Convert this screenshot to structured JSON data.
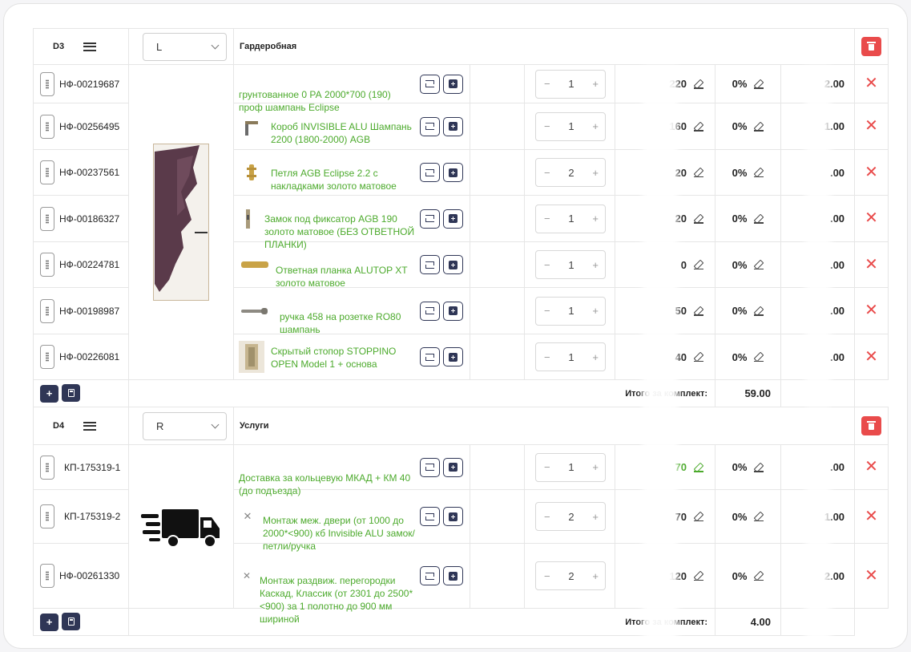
{
  "sets": [
    {
      "code": "D3",
      "side": "L",
      "title": "Гардеробная",
      "total_label": "Итого за комплект:",
      "total": "59.00",
      "rows": [
        {
          "code": "НФ-00219687",
          "name": "грунтованное 0 РА 2000*700 (190) проф шампань Eclipse",
          "qty": "1",
          "price": "220",
          "discount": "0%",
          "sum": "2.00"
        },
        {
          "code": "НФ-00256495",
          "name": "Короб INVISIBLE ALU Шампань 2200 (1800-2000) AGB",
          "qty": "1",
          "price": "160",
          "discount": "0%",
          "sum": "1.00"
        },
        {
          "code": "НФ-00237561",
          "name": "Петля AGB Eclipse 2.2 с накладками золото матовое",
          "qty": "2",
          "price": "20",
          "discount": "0%",
          "sum": ".00"
        },
        {
          "code": "НФ-00186327",
          "name": "Замок под фиксатор AGB 190 золото матовое (БЕЗ ОТВЕТНОЙ ПЛАНКИ)",
          "qty": "1",
          "price": "20",
          "discount": "0%",
          "sum": ".00"
        },
        {
          "code": "НФ-00224781",
          "name": "Ответная планка ALUTOP XT золото матовое",
          "qty": "1",
          "price": "0",
          "discount": "0%",
          "sum": ".00"
        },
        {
          "code": "НФ-00198987",
          "name": "ручка 458 на розетке RO80 шампань",
          "qty": "1",
          "price": "50",
          "discount": "0%",
          "sum": ".00"
        },
        {
          "code": "НФ-00226081",
          "name": "Скрытый стопор STOPPINO OPEN Model 1 + основа",
          "qty": "1",
          "price": "40",
          "discount": "0%",
          "sum": ".00"
        }
      ]
    },
    {
      "code": "D4",
      "side": "R",
      "title": "Услуги",
      "total_label": "Итого за комплект:",
      "total": "4.00",
      "rows": [
        {
          "code": "КП-175319-1",
          "name": "Доставка за кольцевую МКАД + КМ 40 (до подъезда)",
          "qty": "1",
          "price": "70",
          "discount": "0%",
          "sum": ".00"
        },
        {
          "code": "КП-175319-2",
          "name": "Монтаж меж. двери (от 1000 до 2000*<900) кб Invisible ALU замок/петли/ручка",
          "qty": "2",
          "price": "70",
          "discount": "0%",
          "sum": "1.00"
        },
        {
          "code": "НФ-00261330",
          "name": "Монтаж раздвиж. перегородки Каскад, Классик (от 2301 до 2500*<900) за 1 полотно до 900 мм шириной",
          "qty": "2",
          "price": "120",
          "discount": "0%",
          "sum": "2.00"
        }
      ]
    }
  ],
  "ui": {
    "minus": "−",
    "plus": "+",
    "add_btn": "+",
    "delete_glyph": "✕"
  },
  "colors": {
    "accent_green": "#4caa2c",
    "navy": "#2f3656",
    "danger": "#e94b4b"
  }
}
